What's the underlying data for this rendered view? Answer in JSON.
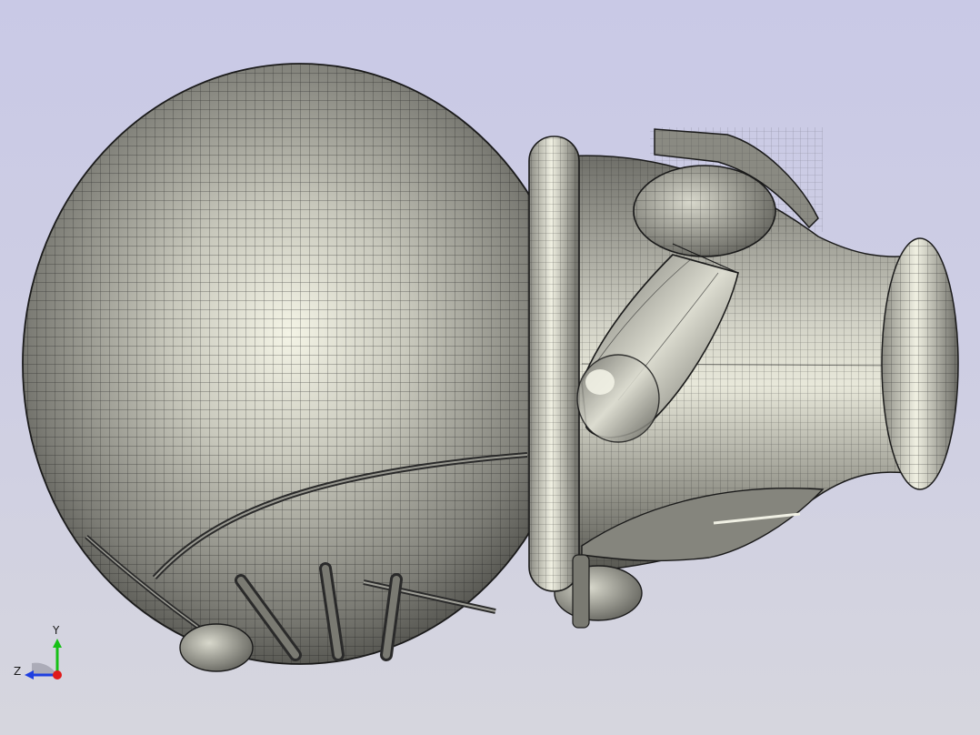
{
  "viewport": {
    "name": "3d-model-viewport",
    "background_top": "#c9c9e6",
    "background_bottom": "#d6d6de",
    "model_color": "#8f8f86",
    "mesh_line_color": "#1c1c1c"
  },
  "triad": {
    "y_label": "Y",
    "z_label": "Z",
    "y_color": "#16c016",
    "z_color": "#1f3fe0",
    "x_color": "#e01a1a"
  }
}
